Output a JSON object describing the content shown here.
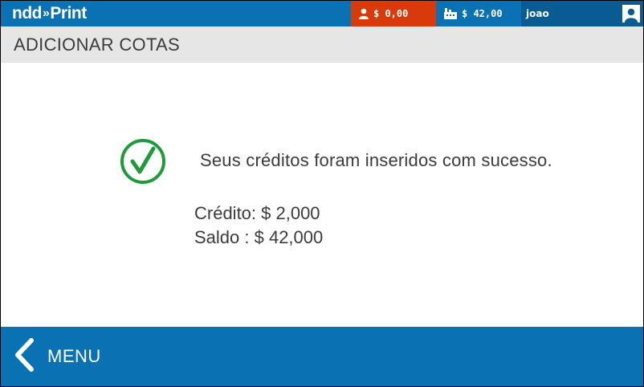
{
  "brand": {
    "logo_left": "ndd",
    "logo_right": "Print"
  },
  "header": {
    "user_balance": "$ 0,00",
    "company_balance": "$ 42,00",
    "username": "joao"
  },
  "page": {
    "title": "ADICIONAR COTAS"
  },
  "result": {
    "message": "Seus créditos foram inseridos com sucesso.",
    "credit_line": "Crédito: $ 2,000",
    "balance_line": "Saldo : $ 42,000"
  },
  "footer": {
    "menu_label": "MENU"
  },
  "icons": {
    "user": "user-icon",
    "company": "building-icon",
    "avatar": "avatar-icon",
    "success": "check-circle-icon",
    "back": "chevron-left-icon"
  },
  "colors": {
    "primary": "#0a72b3",
    "alert": "#d93a0b",
    "success": "#1f9a3a"
  }
}
